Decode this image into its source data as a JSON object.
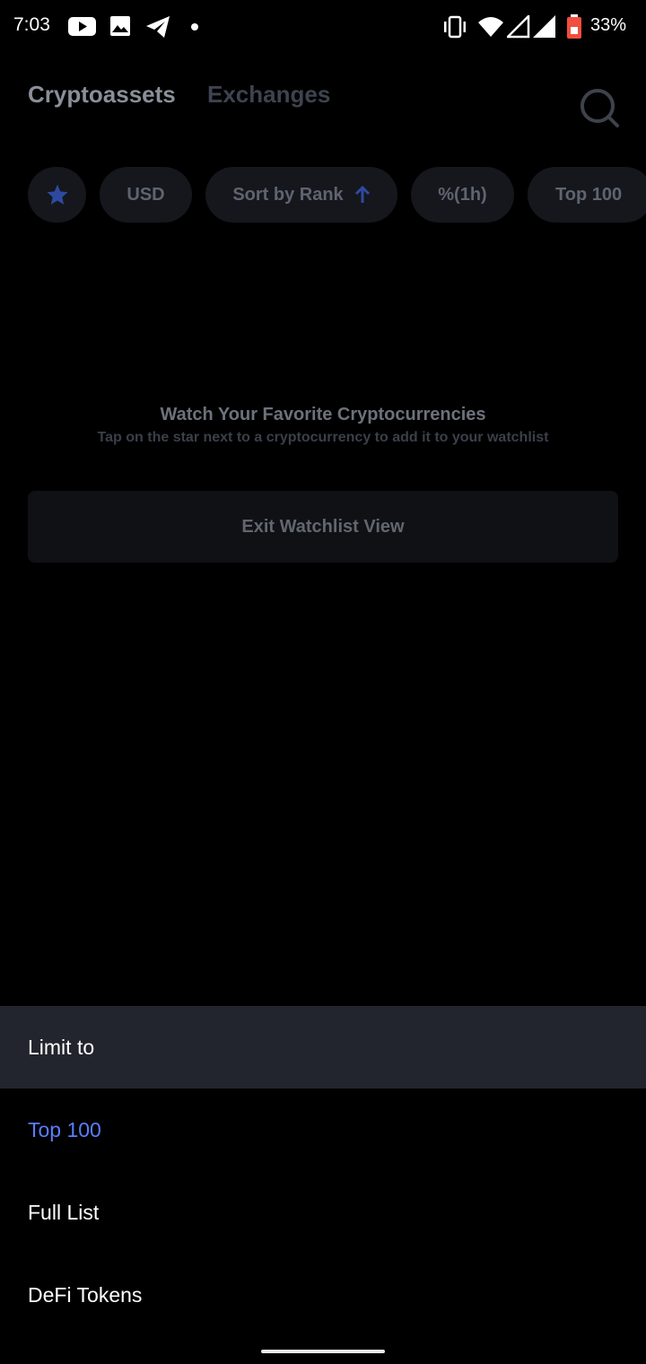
{
  "status_bar": {
    "time": "7:03",
    "battery_percent": "33%",
    "icons": [
      "youtube-icon",
      "gallery-icon",
      "telegram-icon",
      "dot-icon",
      "vibrate-icon",
      "wifi-icon",
      "signal-icon",
      "signal-icon",
      "battery-icon"
    ]
  },
  "header": {
    "tabs": [
      {
        "label": "Cryptoassets",
        "active": true
      },
      {
        "label": "Exchanges",
        "active": false
      }
    ]
  },
  "filters": {
    "watchlist_icon": "star-icon",
    "currency": "USD",
    "sort": "Sort by Rank",
    "sort_icon": "arrow-up-icon",
    "change_period": "%(1h)",
    "limit": "Top 100"
  },
  "empty_state": {
    "title": "Watch Your Favorite Cryptocurrencies",
    "subtitle": "Tap on the star next to a cryptocurrency to add it to your watchlist"
  },
  "exit_button_label": "Exit Watchlist View",
  "sheet": {
    "title": "Limit to",
    "options": [
      {
        "label": "Top 100",
        "selected": true
      },
      {
        "label": "Full List",
        "selected": false
      },
      {
        "label": "DeFi Tokens",
        "selected": false
      }
    ]
  },
  "colors": {
    "accent": "#5a7dff",
    "star": "#2e4aa0",
    "chip_bg": "#15171c",
    "sheet_header_bg": "#22252d"
  }
}
